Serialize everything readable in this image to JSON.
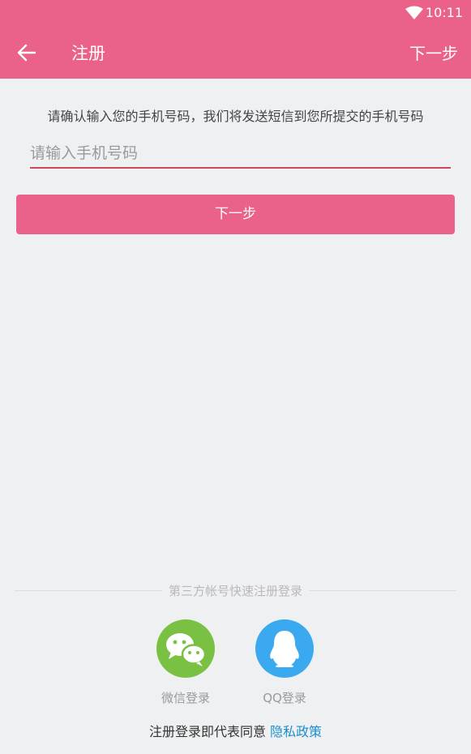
{
  "status_bar": {
    "time": "10:11",
    "wifi_icon": "wifi-icon"
  },
  "toolbar": {
    "back_icon": "arrow-left-icon",
    "title": "注册",
    "next_label": "下一步"
  },
  "form": {
    "hint": "请确认输入您的手机号码，我们将发送短信到您所提交的手机号码",
    "phone_placeholder": "请输入手机号码",
    "submit_label": "下一步"
  },
  "third_party": {
    "divider_text": "第三方帐号快速注册登录",
    "wechat_label": "微信登录",
    "qq_label": "QQ登录"
  },
  "footer": {
    "agreement_text": "注册登录即代表同意",
    "policy_link": "隐私政策"
  },
  "colors": {
    "accent": "#ea6289",
    "wechat": "#7ac143",
    "qq": "#3ba9ef",
    "link": "#1a8fcf"
  }
}
